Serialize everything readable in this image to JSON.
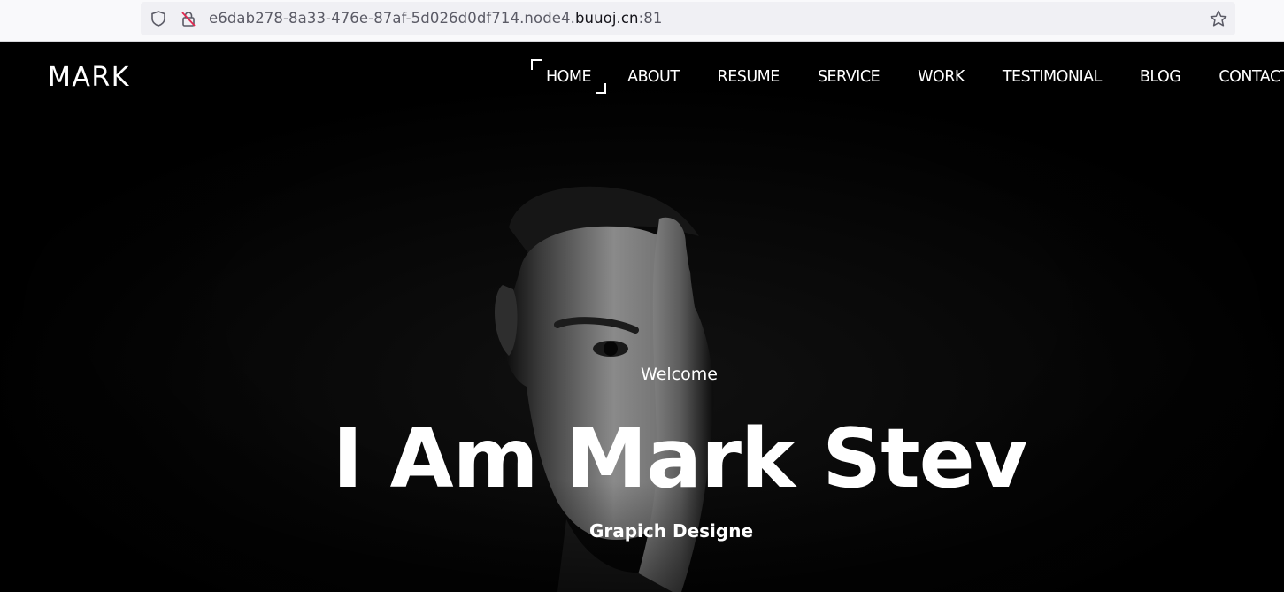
{
  "browser": {
    "url_prefix": "e6dab278-8a33-476e-87af-5d026d0df714.node4.",
    "url_host": "buuoj.cn",
    "url_port": ":81"
  },
  "site": {
    "logo": "MARK",
    "nav": [
      {
        "label": "HOME",
        "active": true
      },
      {
        "label": "ABOUT"
      },
      {
        "label": "RESUME"
      },
      {
        "label": "SERVICE"
      },
      {
        "label": "WORK"
      },
      {
        "label": "TESTIMONIAL"
      },
      {
        "label": "BLOG"
      },
      {
        "label": "CONTACT"
      }
    ]
  },
  "hero": {
    "welcome": "Welcome",
    "headline": "I Am Mark Stev",
    "subtitle": "Grapich Designe"
  },
  "colors": {
    "background": "#000000",
    "text": "#ffffff",
    "chrome_bg": "#f9f9fb",
    "urlbar_bg": "#f0f0f4"
  }
}
